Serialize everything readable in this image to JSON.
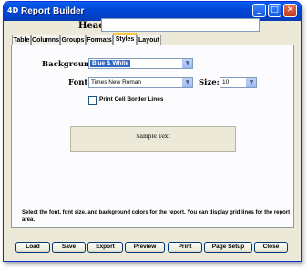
{
  "window": {
    "title": "Report Builder",
    "app_icon": "4D"
  },
  "header": {
    "label": "Header Text:",
    "value": ""
  },
  "tabs": [
    {
      "label": "Table"
    },
    {
      "label": "Columns"
    },
    {
      "label": "Groups"
    },
    {
      "label": "Formats"
    },
    {
      "label": "Styles"
    },
    {
      "label": "Layout"
    }
  ],
  "active_tab": "Styles",
  "styles": {
    "background_label": "Background:",
    "background_value": "Blue & White",
    "font_label": "Font:",
    "font_value": "Times New Roman",
    "size_label": "Size:",
    "size_value": "10",
    "print_border_label": "Print Cell Border Lines",
    "print_border_checked": false,
    "sample_text": "Sample Text"
  },
  "help_text": "Select the font, font size, and background colors for the report.  You can display grid lines for the report area.",
  "buttons": {
    "load": "Load",
    "save": "Save",
    "export": "Export",
    "preview": "Preview",
    "print": "Print",
    "page_setup": "Page Setup",
    "close": "Close"
  },
  "colors": {
    "titlebar": "#0048d8",
    "selection": "#316ac5",
    "active_tab_accent": "#ffc83c",
    "window_face": "#ece9d8"
  }
}
